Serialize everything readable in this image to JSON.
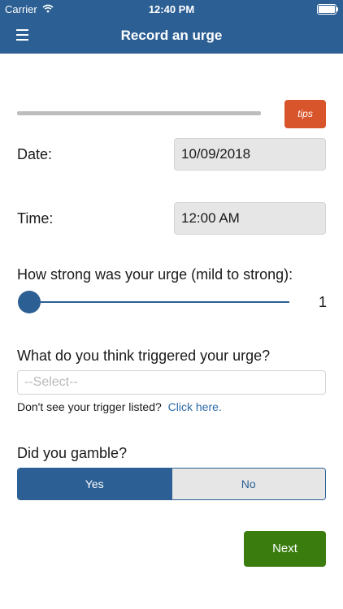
{
  "status_bar": {
    "carrier": "Carrier",
    "time": "12:40 PM"
  },
  "nav": {
    "title": "Record an urge",
    "menu_icon": "hamburger-menu-icon"
  },
  "progress": {
    "value": 0
  },
  "tips_label": "tips",
  "date": {
    "label": "Date:",
    "value": "10/09/2018"
  },
  "time": {
    "label": "Time:",
    "value": "12:00 AM"
  },
  "strength": {
    "label": "How strong was your urge (mild to strong):",
    "value": "1"
  },
  "trigger": {
    "label": "What do you think triggered your urge?",
    "placeholder": "--Select--",
    "hint": "Don't see your trigger listed?",
    "link": "Click here."
  },
  "gamble": {
    "label": "Did you gamble?",
    "yes": "Yes",
    "no": "No",
    "selected": "Yes"
  },
  "next_label": "Next",
  "colors": {
    "primary": "#2c5f94",
    "tips": "#d8542a",
    "next": "#3a7d0e"
  }
}
